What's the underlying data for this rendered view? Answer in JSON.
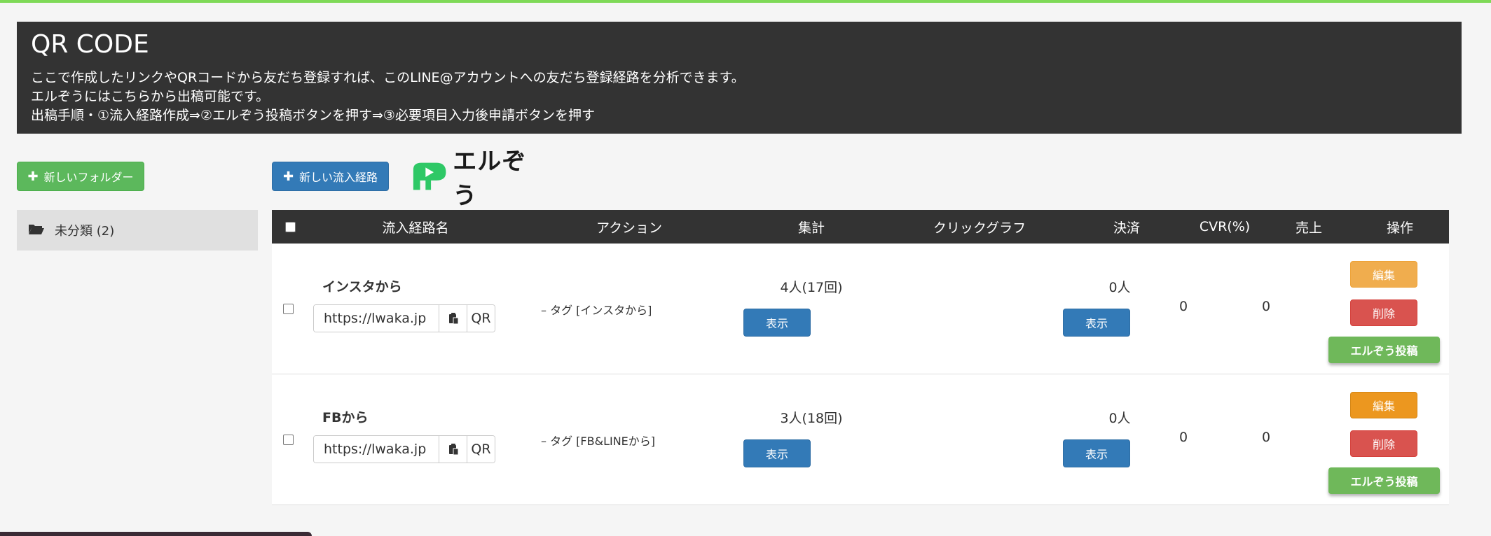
{
  "banner": {
    "title": "QR CODE",
    "line1": "ここで作成したリンクやQRコードから友だち登録すれば、このLINE@アカウントへの友だち登録経路を分析できます。",
    "line2": "エルぞうにはこちらから出稿可能です。",
    "line3": "出稿手順・①流入経路作成⇒②エルぞう投稿ボタンを押す⇒③必要項目入力後申請ボタンを押す"
  },
  "sidebar": {
    "new_folder_label": "新しいフォルダー",
    "folders": [
      {
        "label": "未分類 (2)"
      }
    ]
  },
  "toolbar": {
    "new_route_label": "新しい流入経路",
    "logo_text": "エルぞう"
  },
  "table": {
    "headers": {
      "name": "流入経路名",
      "action": "アクション",
      "count": "集計",
      "click_graph": "クリックグラフ",
      "payment": "決済",
      "cvr": "CVR(%)",
      "sales": "売上",
      "ops": "操作"
    },
    "rows": [
      {
        "name": "インスタから",
        "url": "https://lwaka.jp",
        "qr_label": "QR",
        "action": "– タグ [インスタから]",
        "count": "4人(17回)",
        "count_show": "表示",
        "payment": "0人",
        "payment_show": "表示",
        "cvr": "0",
        "sales": "0",
        "edit_label": "編集",
        "delete_label": "削除",
        "post_label": "エルぞう投稿"
      },
      {
        "name": "FBから",
        "url": "https://lwaka.jp",
        "qr_label": "QR",
        "action": "– タグ [FB&LINEから]",
        "count": "3人(18回)",
        "count_show": "表示",
        "payment": "0人",
        "payment_show": "表示",
        "cvr": "0",
        "sales": "0",
        "edit_label": "編集",
        "delete_label": "削除",
        "post_label": "エルぞう投稿"
      }
    ]
  },
  "colors": {
    "edit_row1": "#f0ad4e",
    "edit_row2": "#ec971f",
    "brand_green": "#2ec866"
  }
}
